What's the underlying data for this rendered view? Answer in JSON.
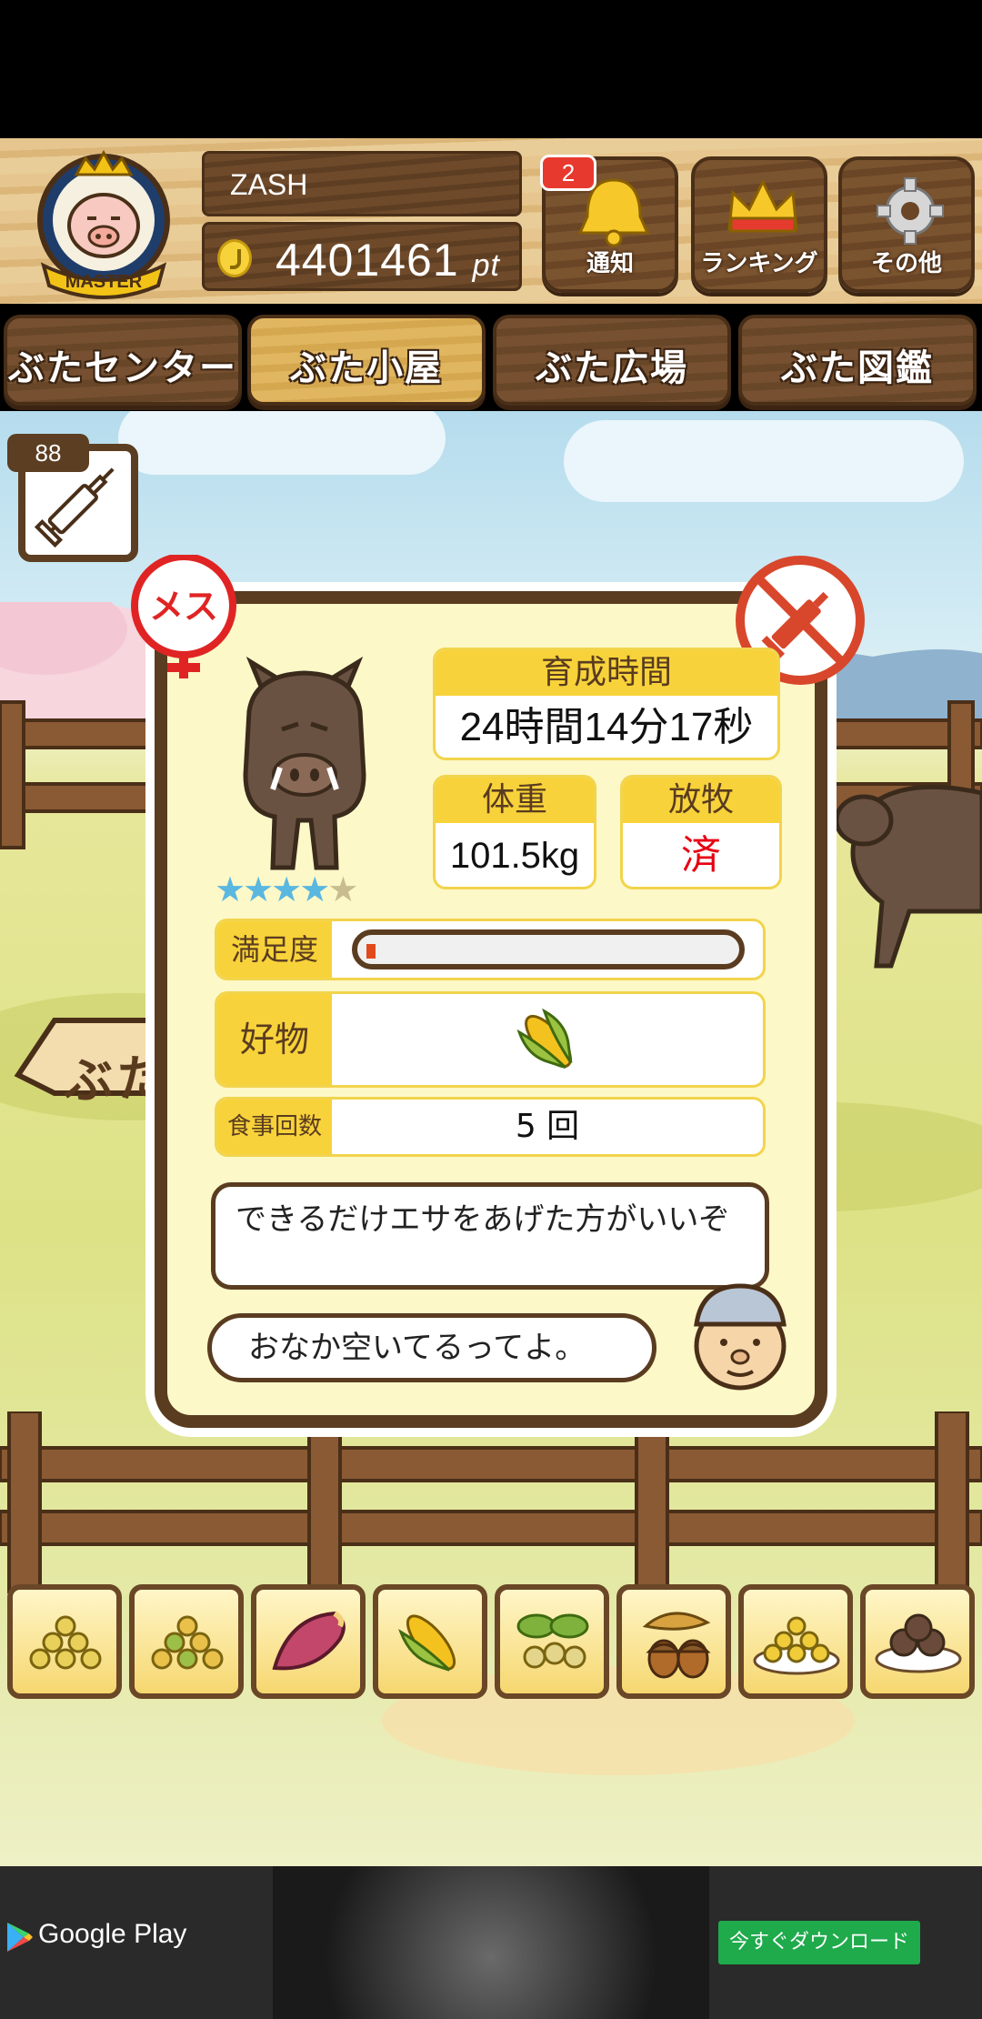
{
  "header": {
    "player_name": "ZASH",
    "points": "4401461",
    "points_unit": "pt",
    "badge_text": "MASTER",
    "notify_label": "通知",
    "notify_count": "2",
    "ranking_label": "ランキング",
    "other_label": "その他"
  },
  "tabs": [
    {
      "label": "ぶたセンター",
      "active": false
    },
    {
      "label": "ぶた小屋",
      "active": true
    },
    {
      "label": "ぶた広場",
      "active": false
    },
    {
      "label": "ぶた図鑑",
      "active": false
    }
  ],
  "item": {
    "count": "88",
    "icon": "syringe-icon"
  },
  "pig": {
    "gender_label": "メス",
    "stars_filled": 4,
    "stars_total": 5,
    "growth_time_label": "育成時間",
    "growth_time": "24時間14分17秒",
    "weight_label": "体重",
    "weight": "101.5kg",
    "grazing_label": "放牧",
    "grazing_value": "済",
    "satiety_label": "満足度",
    "satiety_level": 0.02,
    "favorite_label": "好物",
    "favorite_icon": "corn-icon",
    "meals_label": "食事回数",
    "meals_value": "5 回"
  },
  "dialog": {
    "advice": "できるだけエサをあげた方がいいぞ",
    "status": "おなか空いてるってよ。"
  },
  "sign_label": "ぶた小屋",
  "food_items": [
    "grain-icon",
    "mixed-grain-icon",
    "sweet-potato-icon",
    "corn-icon",
    "soybean-icon",
    "acorn-icon",
    "rice-plate-icon",
    "meatball-plate-icon"
  ],
  "ad": {
    "store_label": "Google Play",
    "cta_label": "今すぐダウンロード"
  },
  "colors": {
    "wood_dark": "#5a3c20",
    "panel_bg": "#fdf8c8",
    "label_yellow": "#f7d23a",
    "grazing_red": "#e60012",
    "star_blue": "#5ab7e0"
  }
}
